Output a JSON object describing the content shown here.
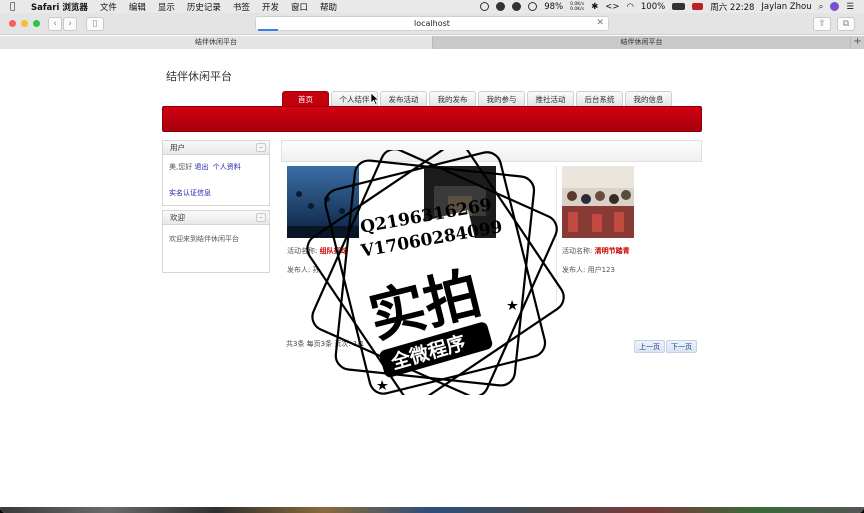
{
  "menubar": {
    "app": "Safari 浏览器",
    "items": [
      "文件",
      "编辑",
      "显示",
      "历史记录",
      "书签",
      "开发",
      "窗口",
      "帮助"
    ],
    "battery_small": "98%",
    "net_up": "0.0K/s",
    "net_down": "0.0K/s",
    "battery": "100%",
    "clock": "周六 22:28",
    "user": "Jaylan Zhou"
  },
  "browser": {
    "address": "localhost",
    "tabs": [
      {
        "label": "结伴休闲平台",
        "active": true
      },
      {
        "label": "结伴休闲平台",
        "active": false
      }
    ],
    "new_tab": "+"
  },
  "site": {
    "title": "结伴休闲平台",
    "nav": [
      "首页",
      "个人结伴",
      "发布活动",
      "我的发布",
      "我的参与",
      "推社活动",
      "后台系统",
      "我的信息"
    ],
    "active_nav": 0,
    "accent": "#c4000f"
  },
  "sidebar": {
    "user_panel": {
      "title": "用户",
      "greeting": "美,您好",
      "logout": "退出",
      "profile": "个人资料",
      "verify": "实名认证信息"
    },
    "welcome_panel": {
      "title": "欢迎",
      "text": "欢迎来到结伴休闲平台"
    }
  },
  "activities": [
    {
      "name_label": "活动名称:",
      "name": "组队打球",
      "publisher_label": "发布人:",
      "publisher": "孙"
    },
    {
      "name_label": "活动名称:",
      "name": "组队",
      "publisher_label": "发布人:",
      "publisher": ""
    },
    {
      "name_label": "活动名称:",
      "name": "清明节踏青",
      "publisher_label": "发布人:",
      "publisher": "用户123"
    }
  ],
  "pager": {
    "info": "共3条 每页3条 页次: 1/1",
    "prev": "上一页",
    "next": "下一页"
  },
  "watermark": {
    "qq": "Q2196316269",
    "v": "V17060284099",
    "main": "实拍",
    "sub": "全微程序"
  }
}
